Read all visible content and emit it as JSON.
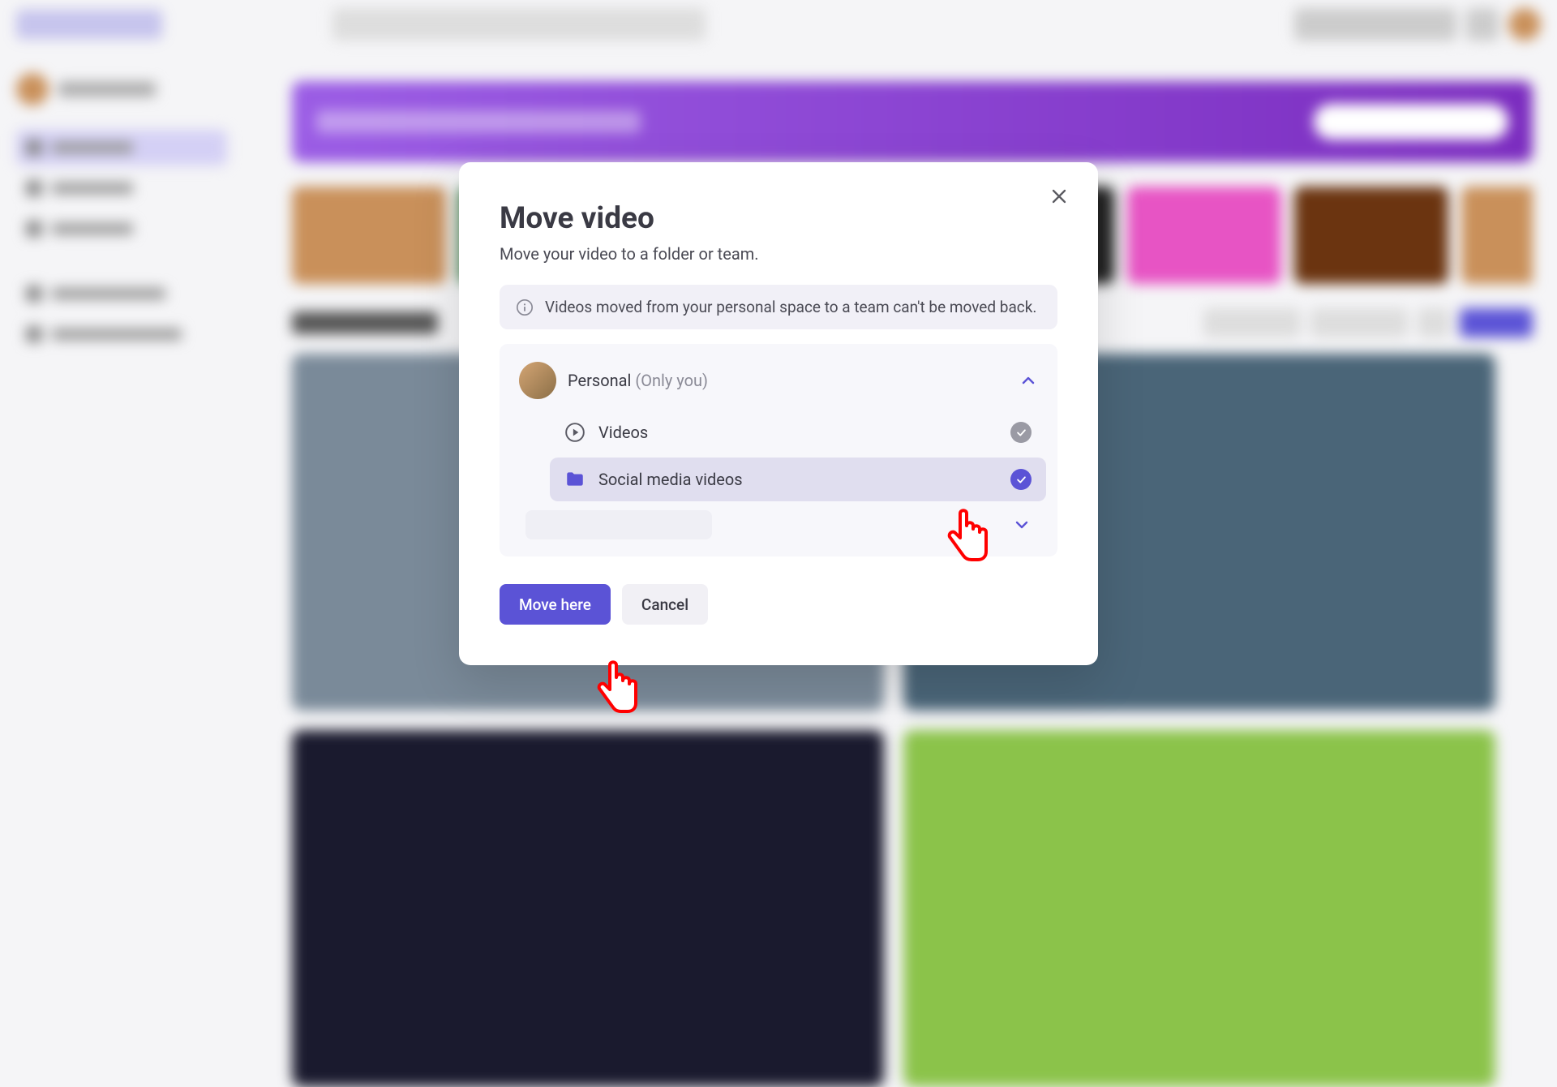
{
  "modal": {
    "title": "Move video",
    "subtitle": "Move your video to a folder or team.",
    "info": "Videos moved from your personal space to a team can't be moved back.",
    "space": {
      "name": "Personal",
      "hint": "(Only you)"
    },
    "folders": [
      {
        "label": "Videos",
        "selected": false
      },
      {
        "label": "Social media videos",
        "selected": true
      }
    ],
    "actions": {
      "primary": "Move here",
      "secondary": "Cancel"
    }
  }
}
